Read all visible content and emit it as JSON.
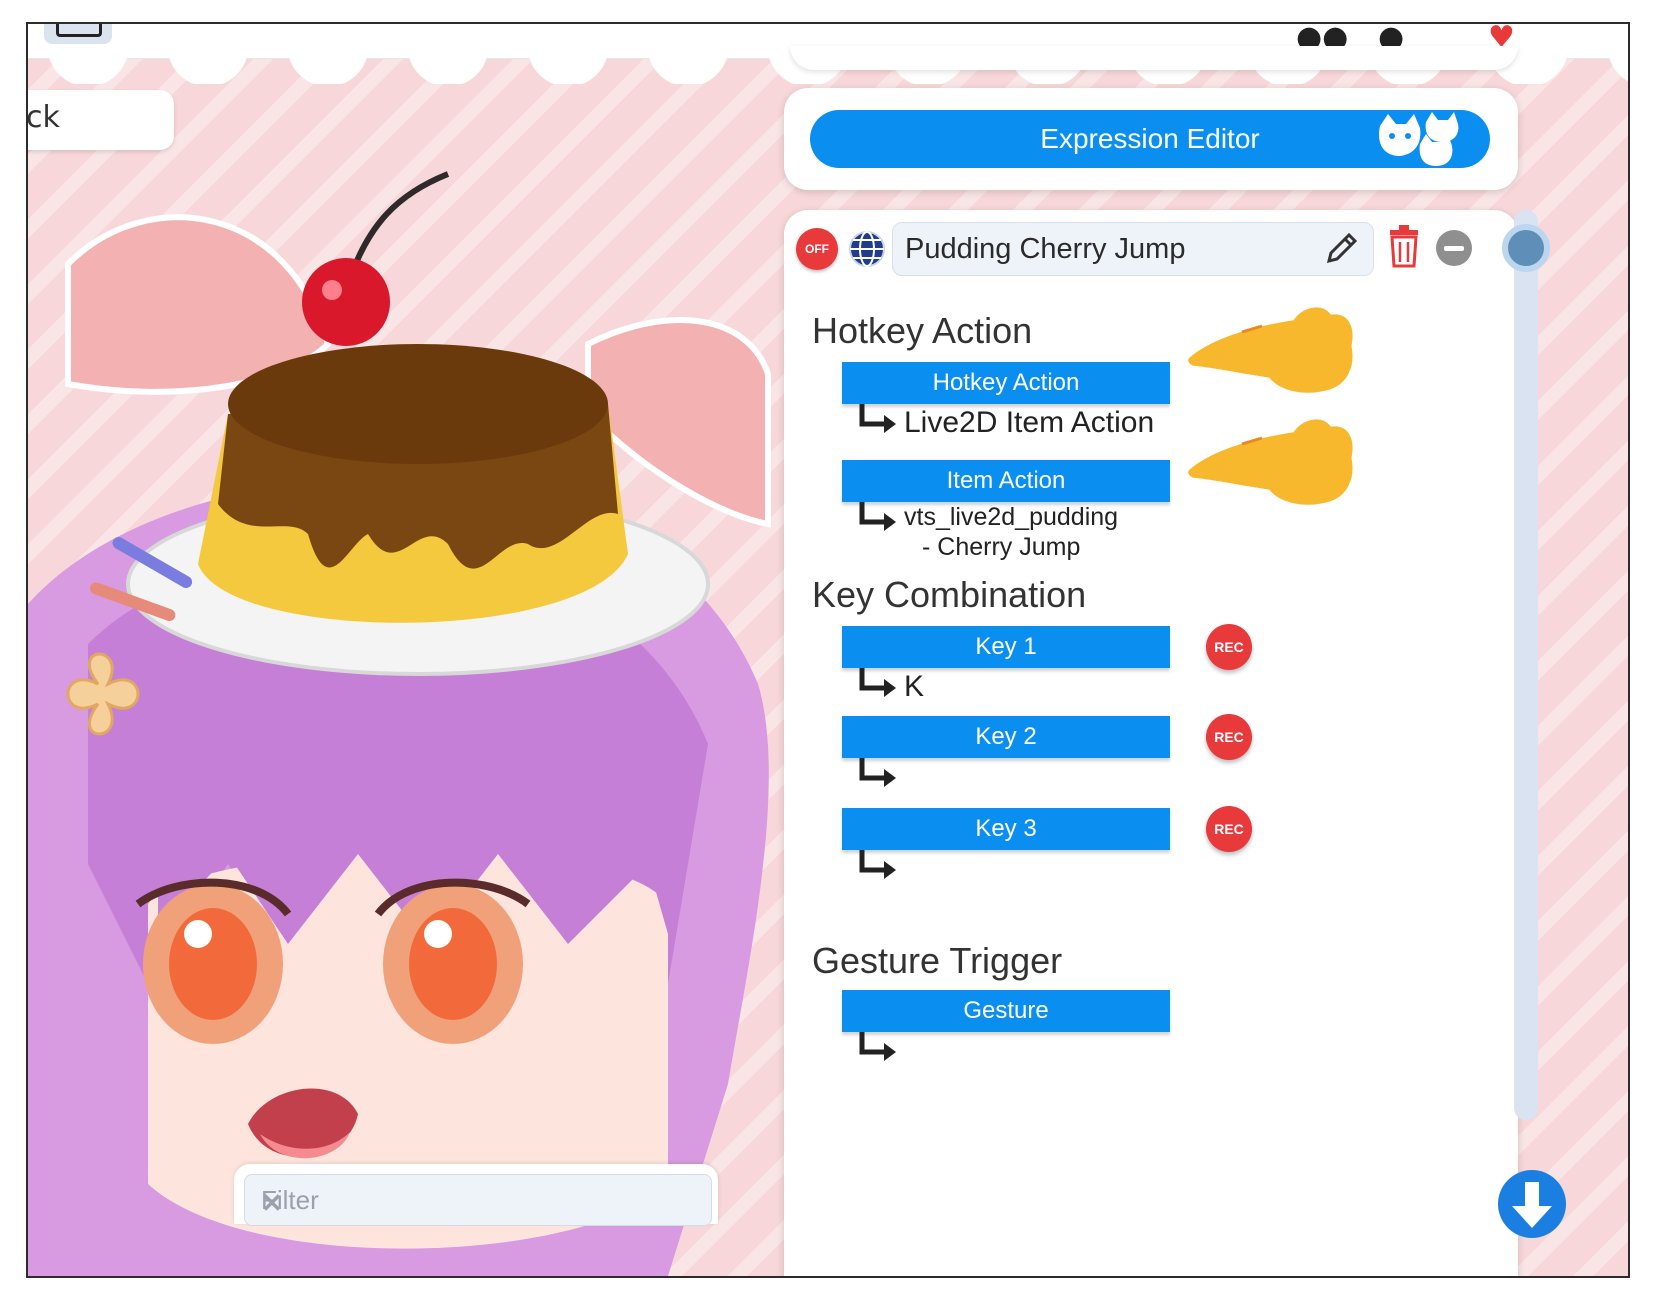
{
  "back_card": {
    "text": "ck"
  },
  "expression_editor": {
    "label": "Expression Editor"
  },
  "hotkey": {
    "off_label": "OFF",
    "name": "Pudding Cherry Jump",
    "hotkey_action_heading": "Hotkey Action",
    "hotkey_action_button": "Hotkey Action",
    "hotkey_action_value": "Live2D Item Action",
    "item_action_button": "Item Action",
    "item_action_value_line1": "vts_live2d_pudding",
    "item_action_value_line2": "- Cherry Jump",
    "key_combination_heading": "Key Combination",
    "keys": [
      {
        "label": "Key 1",
        "value": "K",
        "rec": "REC"
      },
      {
        "label": "Key 2",
        "value": "",
        "rec": "REC"
      },
      {
        "label": "Key 3",
        "value": "",
        "rec": "REC"
      }
    ],
    "gesture_heading": "Gesture Trigger",
    "gesture_button": "Gesture",
    "gesture_value": ""
  },
  "filter": {
    "placeholder": "Filter"
  },
  "colors": {
    "accent": "#0a8ff0",
    "rec": "#e8393b",
    "background": "#f7d7d9"
  },
  "icons": [
    "globe-icon",
    "pencil-icon",
    "trash-icon",
    "minus-icon",
    "pointing-hand-icon",
    "cat-icon",
    "arrow-down-icon",
    "close-icon"
  ]
}
